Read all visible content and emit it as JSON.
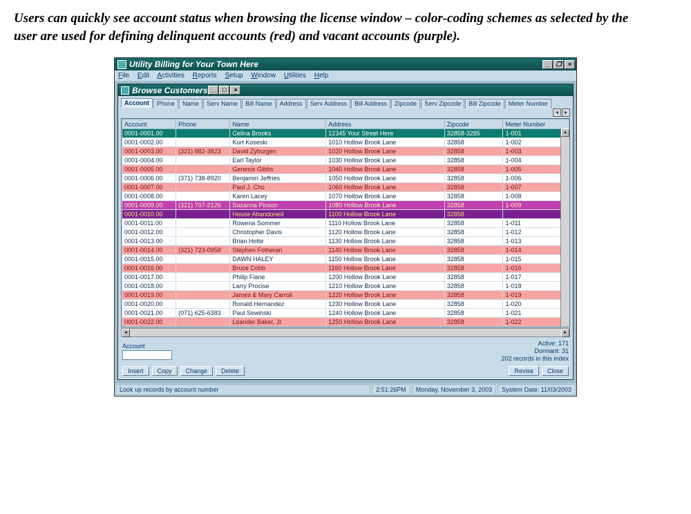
{
  "caption": "Users can quickly see account status when browsing the license window – color-coding schemes as selected by the user are used for defining delinquent accounts (red) and vacant accounts (purple).",
  "app": {
    "title": "Utility Billing for Your Town Here",
    "menu": [
      "File",
      "Edit",
      "Activities",
      "Reports",
      "Setup",
      "Window",
      "Utilities",
      "Help"
    ]
  },
  "child": {
    "title": "Browse Customers"
  },
  "tabs": [
    "Account",
    "Phone",
    "Name",
    "Serv Name",
    "Bill Name",
    "Address",
    "Serv Address",
    "Bill Address",
    "Zipcode",
    "Serv Zipcode",
    "Bill Zipcode",
    "Meter Number"
  ],
  "active_tab": 0,
  "columns": [
    "Account",
    "Phone",
    "Name",
    "Address",
    "Zipcode",
    "Meter Number"
  ],
  "rows": [
    {
      "status": "selected",
      "account": "0001-0001.00",
      "phone": "",
      "name": "Celina Brooks",
      "address": "12345 Your Street Here",
      "zip": "32858-3285",
      "meter": "1-001"
    },
    {
      "status": "normal",
      "account": "0001-0002.00",
      "phone": "",
      "name": "Kurt Koseski",
      "address": "1010 Hollow Brook Lane",
      "zip": "32858",
      "meter": "1-002"
    },
    {
      "status": "delinquent",
      "account": "0001-0003.00",
      "phone": "(321) 882-3823",
      "name": "David Zyburgen",
      "address": "1020 Hollow Brook Lane",
      "zip": "32858",
      "meter": "1-003"
    },
    {
      "status": "normal",
      "account": "0001-0004.00",
      "phone": "",
      "name": "Earl Taylor",
      "address": "1030 Hollow Brook Lane",
      "zip": "32858",
      "meter": "1-004"
    },
    {
      "status": "delinquent",
      "account": "0001-0005.00",
      "phone": "",
      "name": "Genesis Gibbs",
      "address": "1040 Hollow Brook Lane",
      "zip": "32858",
      "meter": "1-005"
    },
    {
      "status": "normal",
      "account": "0001-0006.00",
      "phone": "(371) 738-8920",
      "name": "Benjamin Jeffries",
      "address": "1050 Hollow Brook Lane",
      "zip": "32858",
      "meter": "1-006"
    },
    {
      "status": "delinquent",
      "account": "0001-0007.00",
      "phone": "",
      "name": "Paul J. Cho",
      "address": "1060 Hollow Brook Lane",
      "zip": "32858",
      "meter": "1-007"
    },
    {
      "status": "normal",
      "account": "0001-0008.00",
      "phone": "",
      "name": "Karen Lacey",
      "address": "1070 Hollow Brook Lane",
      "zip": "32858",
      "meter": "1-008"
    },
    {
      "status": "vacant2",
      "account": "0001-0009.00",
      "phone": "(321) 707-2126",
      "name": "Suzanna Pinson",
      "address": "1080 Hollow Brook Lane",
      "zip": "32858",
      "meter": "1-009"
    },
    {
      "status": "vacant",
      "account": "0001-0010.00",
      "phone": "",
      "name": "House Abandoned",
      "address": "1100 Hollow Brook Lane",
      "zip": "32858",
      "meter": ""
    },
    {
      "status": "normal",
      "account": "0001-0011.00",
      "phone": "",
      "name": "Rowena Sommer",
      "address": "1110 Hollow Brook Lane",
      "zip": "32858",
      "meter": "1-011"
    },
    {
      "status": "normal",
      "account": "0001-0012.00",
      "phone": "",
      "name": "Christopher Davis",
      "address": "1120 Hollow Brook Lane",
      "zip": "32858",
      "meter": "1-012"
    },
    {
      "status": "normal",
      "account": "0001-0013.00",
      "phone": "",
      "name": "Brian Hotte",
      "address": "1130 Hollow Brook Lane",
      "zip": "32858",
      "meter": "1-013"
    },
    {
      "status": "delinquent",
      "account": "0001-0014.00",
      "phone": "(321) 723-0958",
      "name": "Stephen Fotheran",
      "address": "1140 Hollow Brook Lane",
      "zip": "32858",
      "meter": "1-014"
    },
    {
      "status": "normal",
      "account": "0001-0015.00",
      "phone": "",
      "name": "DAWN HALEY",
      "address": "1150 Hollow Brook Lane",
      "zip": "32858",
      "meter": "1-015"
    },
    {
      "status": "delinquent",
      "account": "0001-0016.00",
      "phone": "",
      "name": "Bruce Cobb",
      "address": "1160 Hollow Brook Lane",
      "zip": "32858",
      "meter": "1-016"
    },
    {
      "status": "normal",
      "account": "0001-0017.00",
      "phone": "",
      "name": "Philip Fiane",
      "address": "1200 Hollow Brook Lane",
      "zip": "32858",
      "meter": "1-017"
    },
    {
      "status": "normal",
      "account": "0001-0018.00",
      "phone": "",
      "name": "Larry Procise",
      "address": "1210 Hollow Brook Lane",
      "zip": "32858",
      "meter": "1-018"
    },
    {
      "status": "delinquent",
      "account": "0001-0019.00",
      "phone": "",
      "name": "James & Mary Carroll",
      "address": "1220 Hollow Brook Lane",
      "zip": "32858",
      "meter": "1-019"
    },
    {
      "status": "normal",
      "account": "0001-0020.00",
      "phone": "",
      "name": "Ronald Hernandez",
      "address": "1230 Hollow Brook Lane",
      "zip": "32858",
      "meter": "1-020"
    },
    {
      "status": "normal",
      "account": "0001-0021.00",
      "phone": "(071) 625-6383",
      "name": "Paul Sewinski",
      "address": "1240 Hollow Brook Lane",
      "zip": "32858",
      "meter": "1-021"
    },
    {
      "status": "delinquent",
      "account": "0001-0022.00",
      "phone": "",
      "name": "Leander Baker, Jr.",
      "address": "1250 Hollow Brook Lane",
      "zip": "32858",
      "meter": "1-022"
    }
  ],
  "footer": {
    "account_label": "Account",
    "stats": {
      "active": "Active: 171",
      "dormant": "Dormant: 31",
      "records": "202 records in this index"
    }
  },
  "buttons": {
    "insert": "Insert",
    "copy": "Copy",
    "change": "Change",
    "delete": "Delete",
    "revise": "Revise",
    "close": "Close"
  },
  "status": {
    "hint": "Look up records by account number",
    "time": "2:51:26PM",
    "date": "Monday, November 3, 2003",
    "sysdate": "System Date: 11/03/2003"
  }
}
